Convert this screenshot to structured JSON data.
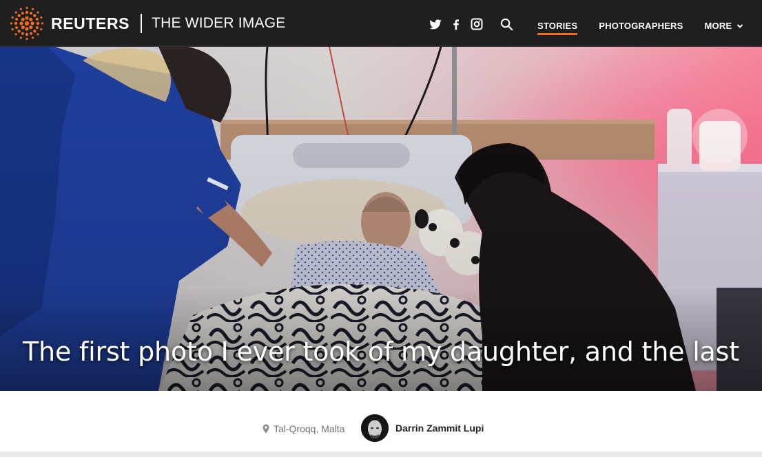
{
  "header": {
    "brand_name": "REUTERS",
    "section_title": "THE WIDER IMAGE",
    "brand_color": "#f26b21",
    "social_icons": [
      "twitter-icon",
      "facebook-icon",
      "instagram-icon"
    ],
    "search_icon": "search-icon",
    "nav": {
      "stories": "STORIES",
      "photographers": "PHOTOGRAPHERS",
      "more": "MORE"
    },
    "active_nav": "STORIES"
  },
  "hero": {
    "title": "The first photo I ever took of my daughter, and the last"
  },
  "byline": {
    "location": "Tal-Qroqq, Malta",
    "author_name": "Darrin Zammit Lupi"
  }
}
